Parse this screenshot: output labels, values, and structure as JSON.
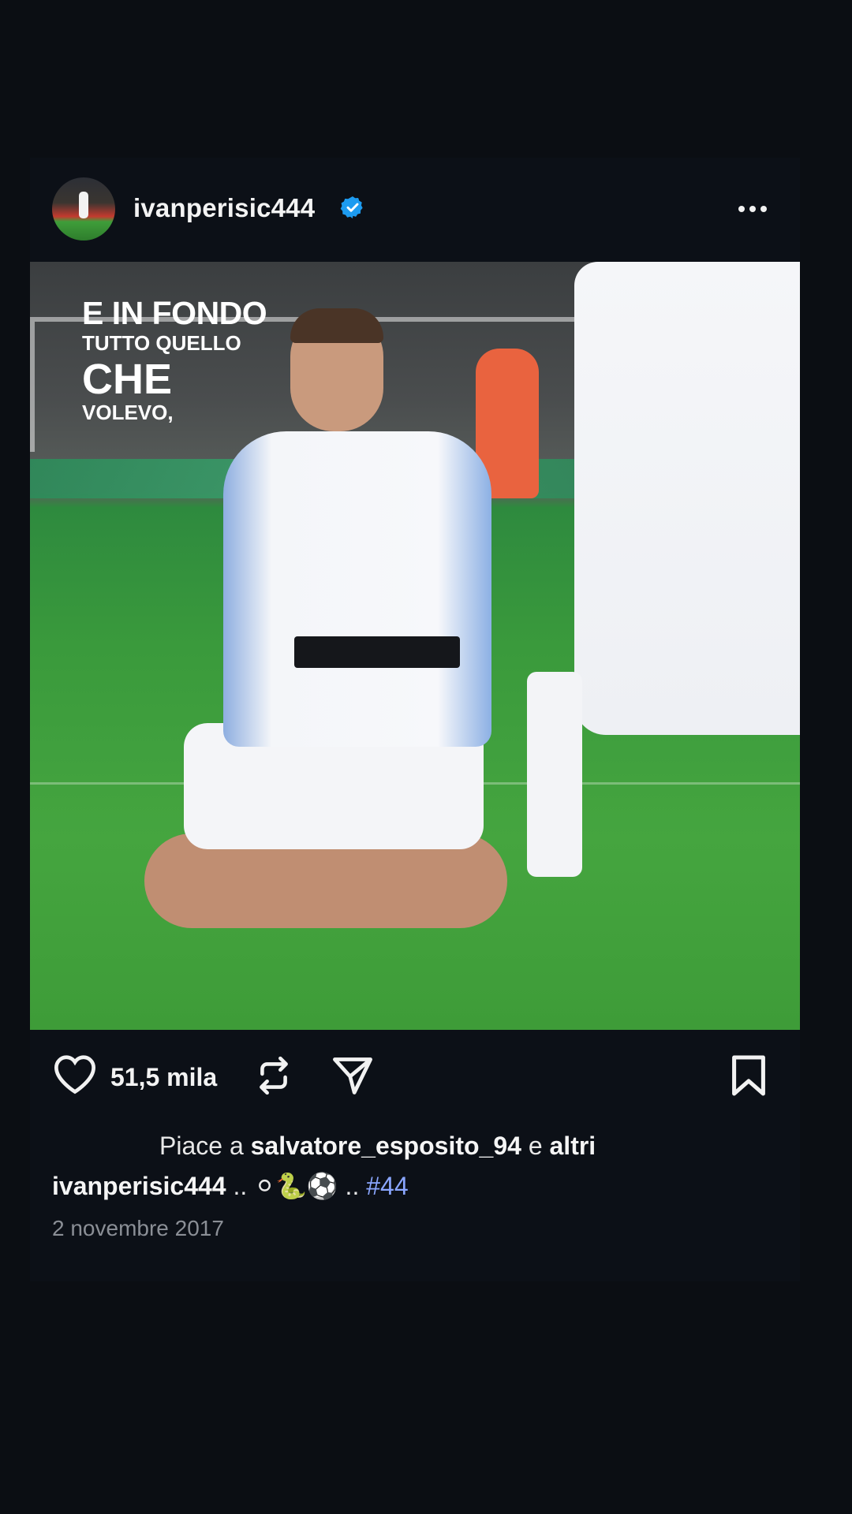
{
  "post": {
    "username": "ivanperisic444",
    "verified_icon": "verified-badge-icon",
    "more_icon": "more-horizontal-icon",
    "image_overlay_text": {
      "line1": "E IN FONDO",
      "line2": "TUTTO QUELLO",
      "line3": "CHE",
      "line4": "VOLEVO,"
    },
    "actions": {
      "like_icon": "heart-icon",
      "likes_count": "51,5 mila",
      "repost_icon": "repost-icon",
      "share_icon": "send-icon",
      "save_icon": "bookmark-icon"
    },
    "liked_by": {
      "prefix": "Piace a",
      "user": "salvatore_esposito_94",
      "joiner": "e",
      "others": "altri"
    },
    "caption": {
      "username": "ivanperisic444",
      "text_before": "..",
      "emojis": "⚪🐍⚽",
      "text_after": "..",
      "hashtag": "#44"
    },
    "date": "2 novembre 2017"
  },
  "colors": {
    "background": "#0b0e13",
    "verified_blue": "#1d9bf0",
    "hashtag": "#8aa6ff",
    "date_gray": "#8b8f96"
  }
}
